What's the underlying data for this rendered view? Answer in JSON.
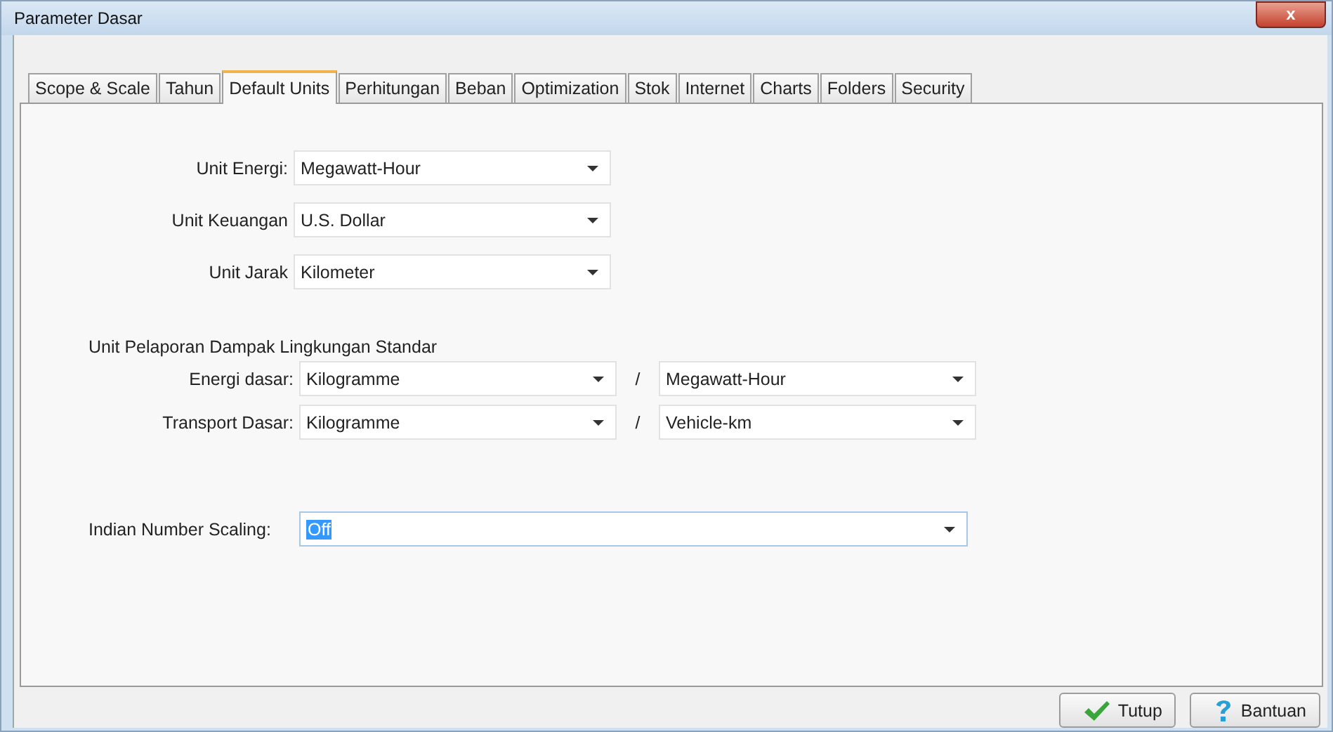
{
  "window": {
    "title": "Parameter Dasar",
    "close": "x"
  },
  "tabs": [
    {
      "label": "Scope & Scale",
      "selected": false
    },
    {
      "label": "Tahun",
      "selected": false
    },
    {
      "label": "Default Units",
      "selected": true
    },
    {
      "label": "Perhitungan",
      "selected": false
    },
    {
      "label": "Beban",
      "selected": false
    },
    {
      "label": "Optimization",
      "selected": false
    },
    {
      "label": "Stok",
      "selected": false
    },
    {
      "label": "Internet",
      "selected": false
    },
    {
      "label": "Charts",
      "selected": false
    },
    {
      "label": "Folders",
      "selected": false
    },
    {
      "label": "Security",
      "selected": false
    }
  ],
  "units": [
    {
      "label": "Unit Energi:",
      "value": "Megawatt-Hour"
    },
    {
      "label": "Unit Keuangan",
      "value": "U.S. Dollar"
    },
    {
      "label": "Unit Jarak",
      "value": "Kilometer"
    }
  ],
  "environmental": {
    "heading": "Unit Pelaporan Dampak Lingkungan Standar",
    "rows": [
      {
        "label": "Energi dasar:",
        "numerator": "Kilogramme",
        "separator": "/",
        "denominator": "Megawatt-Hour"
      },
      {
        "label": "Transport Dasar:",
        "numerator": "Kilogramme",
        "separator": "/",
        "denominator": "Vehicle-km"
      }
    ]
  },
  "indian_scaling": {
    "label": "Indian Number Scaling:",
    "value": "Off",
    "text_selected": true
  },
  "buttons": [
    {
      "kind": "ok",
      "label": "Tutup"
    },
    {
      "kind": "help",
      "label": "Bantuan"
    }
  ]
}
